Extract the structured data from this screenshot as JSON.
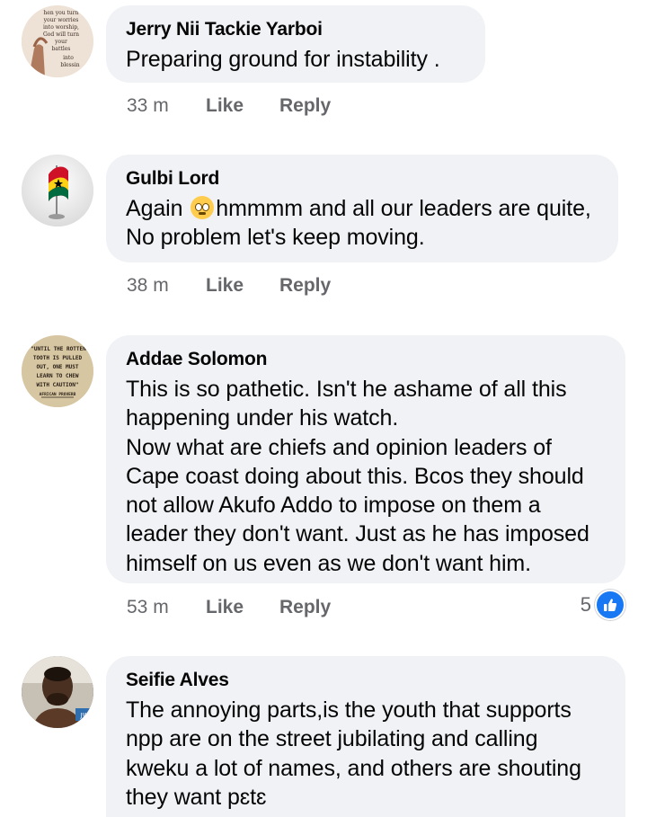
{
  "comments": [
    {
      "author": "Jerry Nii Tackie Yarboi",
      "text_lines": [
        "Preparing ground for instability ."
      ],
      "time": "33 m",
      "like_label": "Like",
      "reply_label": "Reply",
      "avatar_text": [
        "hen you turn",
        "your worries",
        "into worship,",
        "God will turn",
        "your",
        "battles",
        "into",
        "blessin"
      ]
    },
    {
      "author": "Gulbi Lord",
      "text_before_emoji": "Again ",
      "emoji": "rolling-eyes-emoji",
      "text_after_emoji": "hmmmm and all our leaders are quite,",
      "text_line2": "No problem let's keep moving.",
      "time": "38 m",
      "like_label": "Like",
      "reply_label": "Reply"
    },
    {
      "author": "Addae Solomon",
      "text_lines": [
        "This is so pathetic.  Isn't he ashame of all this",
        "happening under his watch.",
        "Now what are chiefs and opinion leaders of",
        "Cape coast doing about this. Bcos they should",
        "not allow Akufo Addo to impose on them a",
        "leader they don't want.  Just as he has imposed",
        "himself on us even as we don't want him."
      ],
      "time": "53 m",
      "like_label": "Like",
      "reply_label": "Reply",
      "reaction_count": "5",
      "avatar_text": [
        "\"UNTIL THE ROTTEN",
        "TOOTH IS PULLED",
        "OUT, ONE MUST",
        "LEARN TO CHEW",
        "WITH CAUTION\"",
        "AFRICAN PROVERB"
      ]
    },
    {
      "author": "Seifie Alves",
      "text_lines": [
        "The annoying parts,is the youth that supports",
        "npp are on the street jubilating and calling",
        "kweku a lot of names, and others are shouting",
        "they want pɛtɛ"
      ],
      "avatar_badge": "JW"
    }
  ],
  "colors": {
    "bubble_bg": "#f0f2f5",
    "meta_text": "#65676b",
    "like_blue": "#1877f2"
  }
}
